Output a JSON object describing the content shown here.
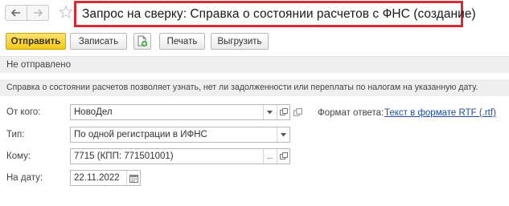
{
  "window": {
    "title": "Запрос на сверку: Справка о состоянии расчетов с ФНС (создание)"
  },
  "toolbar": {
    "send_label": "Отправить",
    "write_label": "Записать",
    "print_label": "Печать",
    "unload_label": "Выгрузить"
  },
  "status": {
    "text": "Не отправлено"
  },
  "info": {
    "text": "Справка о состоянии расчетов позволяет узнать, нет ли задолженности или переплаты по налогам на указанную дату."
  },
  "form": {
    "from_label": "От кого:",
    "from_value": "НовоДел",
    "type_label": "Тип:",
    "type_value": "По одной регистрации в ИФНС",
    "to_label": "Кому:",
    "to_value": "7715 (КПП: 771501001)",
    "date_label": "На дату:",
    "date_value": "22.11.2022",
    "format_label": "Формат ответа:",
    "format_value": "Текст в формате RTF (.rtf)"
  },
  "colors": {
    "accent_yellow": "#f5c819",
    "title_frame_red": "#d42b35",
    "link_blue": "#1c4f9c"
  },
  "icons": {
    "back": "arrow-left-icon",
    "forward": "arrow-right-icon",
    "favorite": "star-icon",
    "add_document": "add-document-icon",
    "dropdown": "chevron-down-icon",
    "open": "external-link-icon",
    "select": "ellipsis-icon",
    "calendar": "calendar-icon"
  }
}
